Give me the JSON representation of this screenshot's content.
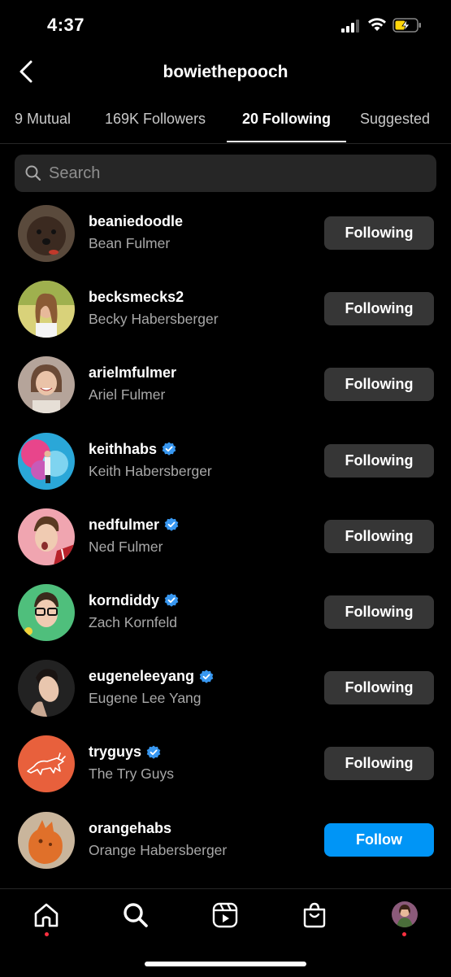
{
  "status_bar": {
    "time": "4:37"
  },
  "header": {
    "title": "bowiethepooch"
  },
  "tabs": [
    {
      "label": "9 Mutual",
      "active": false
    },
    {
      "label": "169K Followers",
      "active": false
    },
    {
      "label": "20 Following",
      "active": true
    },
    {
      "label": "Suggested",
      "active": false
    }
  ],
  "search": {
    "placeholder": "Search"
  },
  "users": [
    {
      "username": "beaniedoodle",
      "name": "Bean Fulmer",
      "verified": false,
      "button": "Following"
    },
    {
      "username": "becksmecks2",
      "name": "Becky Habersberger",
      "verified": false,
      "button": "Following"
    },
    {
      "username": "arielmfulmer",
      "name": "Ariel Fulmer",
      "verified": false,
      "button": "Following"
    },
    {
      "username": "keithhabs",
      "name": "Keith Habersberger",
      "verified": true,
      "button": "Following"
    },
    {
      "username": "nedfulmer",
      "name": "Ned Fulmer",
      "verified": true,
      "button": "Following"
    },
    {
      "username": "korndiddy",
      "name": "Zach Kornfeld",
      "verified": true,
      "button": "Following"
    },
    {
      "username": "eugeneleeyang",
      "name": "Eugene Lee Yang",
      "verified": true,
      "button": "Following"
    },
    {
      "username": "tryguys",
      "name": "The Try Guys",
      "verified": true,
      "button": "Following"
    },
    {
      "username": "orangehabs",
      "name": "Orange Habersberger",
      "verified": false,
      "button": "Follow"
    }
  ],
  "bottom_nav": [
    "home-icon",
    "search-icon",
    "reels-icon",
    "shop-icon",
    "profile-avatar"
  ],
  "colors": {
    "background": "#000000",
    "follow_button": "#0095f6",
    "following_button": "#363636",
    "verified": "#3897f0",
    "notification_dot": "#ff3040"
  }
}
